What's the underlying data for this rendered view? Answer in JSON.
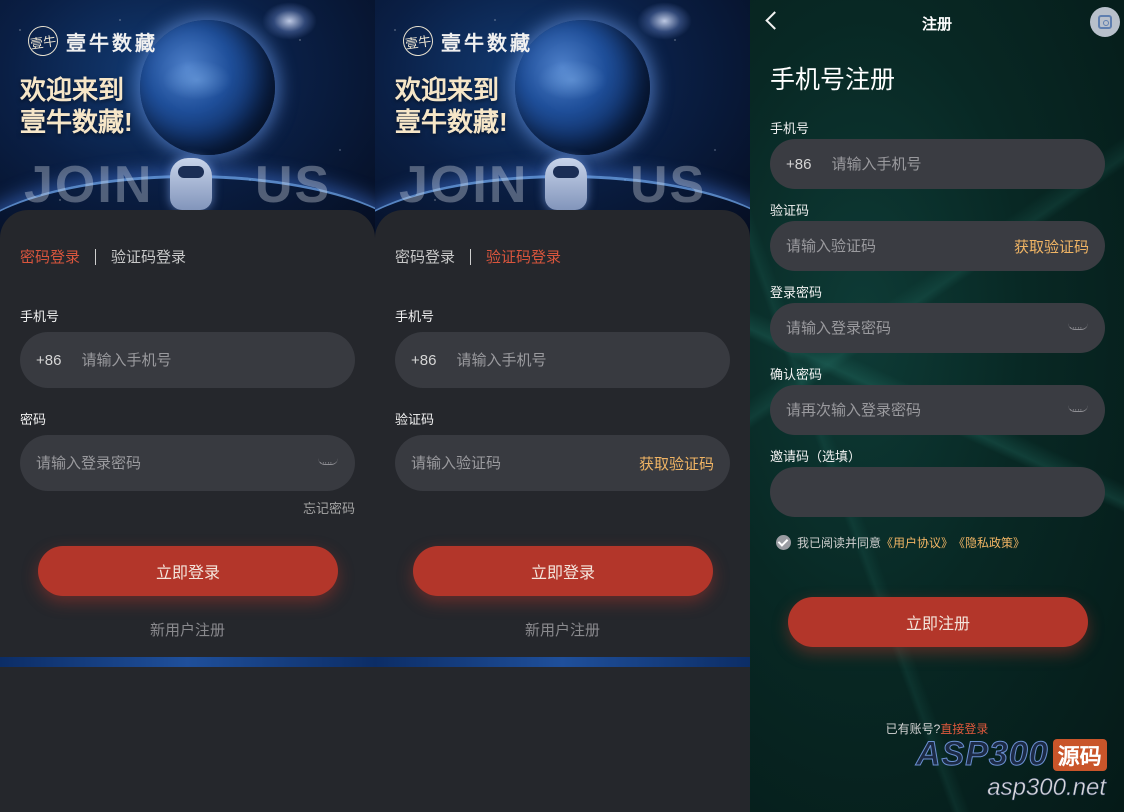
{
  "brand": {
    "logo_mark": "壹牛",
    "name": "壹牛数藏",
    "welcome_line1": "欢迎来到",
    "welcome_line2": "壹牛数藏!",
    "join_left": "JOIN",
    "join_right": "US"
  },
  "login_password": {
    "tabs": [
      {
        "label": "密码登录",
        "active": true
      },
      {
        "label": "验证码登录",
        "active": false
      }
    ],
    "phone_label": "手机号",
    "phone_prefix": "+86",
    "phone_placeholder": "请输入手机号",
    "password_label": "密码",
    "password_placeholder": "请输入登录密码",
    "forgot": "忘记密码",
    "submit": "立即登录",
    "register": "新用户注册"
  },
  "login_code": {
    "tabs": [
      {
        "label": "密码登录",
        "active": false
      },
      {
        "label": "验证码登录",
        "active": true
      }
    ],
    "phone_label": "手机号",
    "phone_prefix": "+86",
    "phone_placeholder": "请输入手机号",
    "code_label": "验证码",
    "code_placeholder": "请输入验证码",
    "get_code": "获取验证码",
    "submit": "立即登录",
    "register": "新用户注册"
  },
  "register": {
    "topbar_title": "注册",
    "title": "手机号注册",
    "phone_label": "手机号",
    "phone_prefix": "+86",
    "phone_placeholder": "请输入手机号",
    "code_label": "验证码",
    "code_placeholder": "请输入验证码",
    "get_code": "获取验证码",
    "password_label": "登录密码",
    "password_placeholder": "请输入登录密码",
    "confirm_label": "确认密码",
    "confirm_placeholder": "请再次输入登录密码",
    "invite_label": "邀请码（选填）",
    "invite_placeholder": "",
    "agree_text": "我已阅读并同意",
    "user_agreement": "《用户协议》",
    "privacy_policy": "《隐私政策》",
    "submit": "立即注册",
    "has_account": "已有账号?",
    "login_link": "直接登录"
  },
  "watermark": {
    "brand": "ASP300",
    "tag": "源码",
    "url": "asp300.net"
  },
  "colors": {
    "accent_red": "#b3362a",
    "active_tab": "#d9553d",
    "code_link": "#f0b464",
    "card_bg": "#25272c",
    "input_bg": "#383a40"
  }
}
